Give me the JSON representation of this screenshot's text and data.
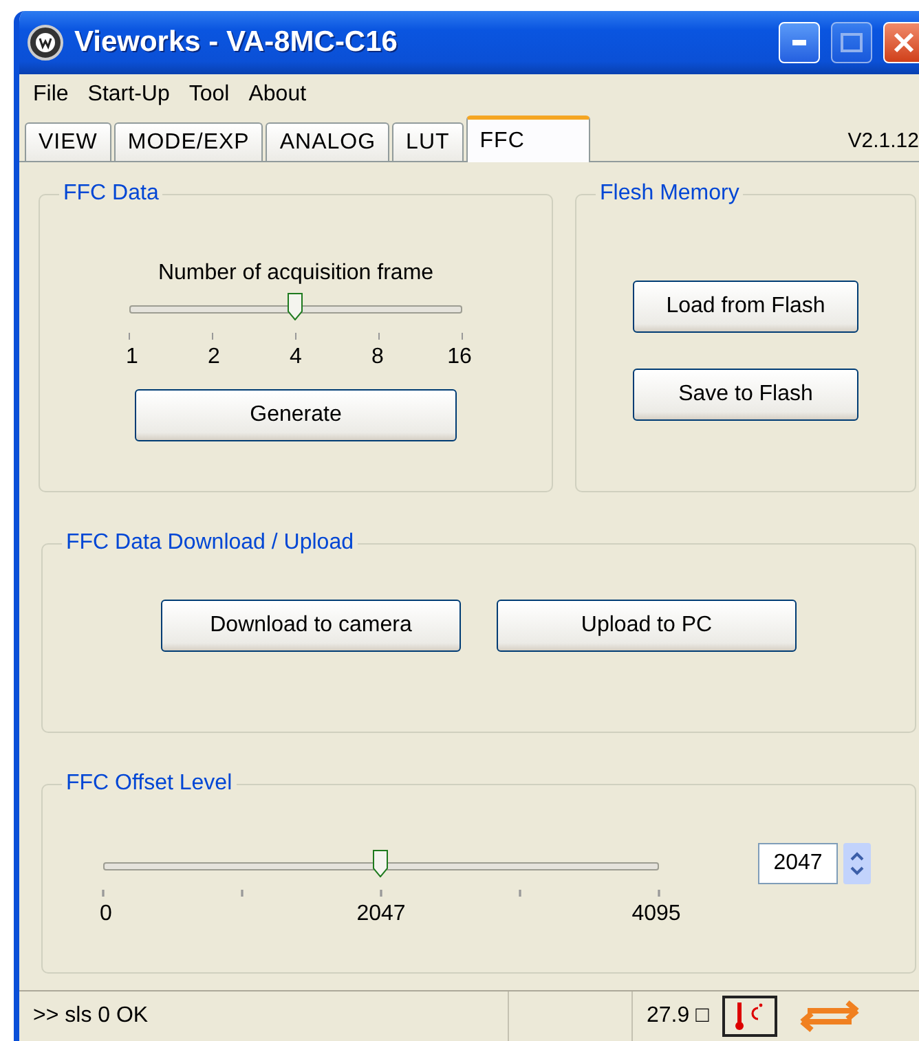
{
  "window": {
    "title": "Vieworks - VA-8MC-C16"
  },
  "menu": [
    "File",
    "Start-Up",
    "Tool",
    "About"
  ],
  "tabs": [
    {
      "label": "VIEW",
      "selected": false
    },
    {
      "label": "MODE/EXP",
      "selected": false
    },
    {
      "label": "ANALOG",
      "selected": false
    },
    {
      "label": "LUT",
      "selected": false
    },
    {
      "label": "FFC",
      "selected": true
    }
  ],
  "version": "V2.1.12",
  "ffc_data": {
    "title": "FFC Data",
    "slider_label": "Number of acquisition frame",
    "slider": {
      "level": 0.5,
      "tick_labels": [
        "1",
        "2",
        "4",
        "8",
        "16"
      ]
    },
    "button": "Generate"
  },
  "flash_memory": {
    "title": "Flesh Memory",
    "buttons": [
      "Load from Flash",
      "Save to Flash"
    ]
  },
  "download_upload": {
    "title": "FFC Data Download / Upload",
    "buttons": [
      "Download to camera",
      "Upload to PC"
    ]
  },
  "offset_level": {
    "title": "FFC Offset Level",
    "slider": {
      "level": 0.5,
      "tick_labels": [
        "0",
        "2047",
        "4095"
      ]
    },
    "value": "2047"
  },
  "status_bar": {
    "message": ">> sls 0  OK",
    "temperature": "27.9 □"
  }
}
